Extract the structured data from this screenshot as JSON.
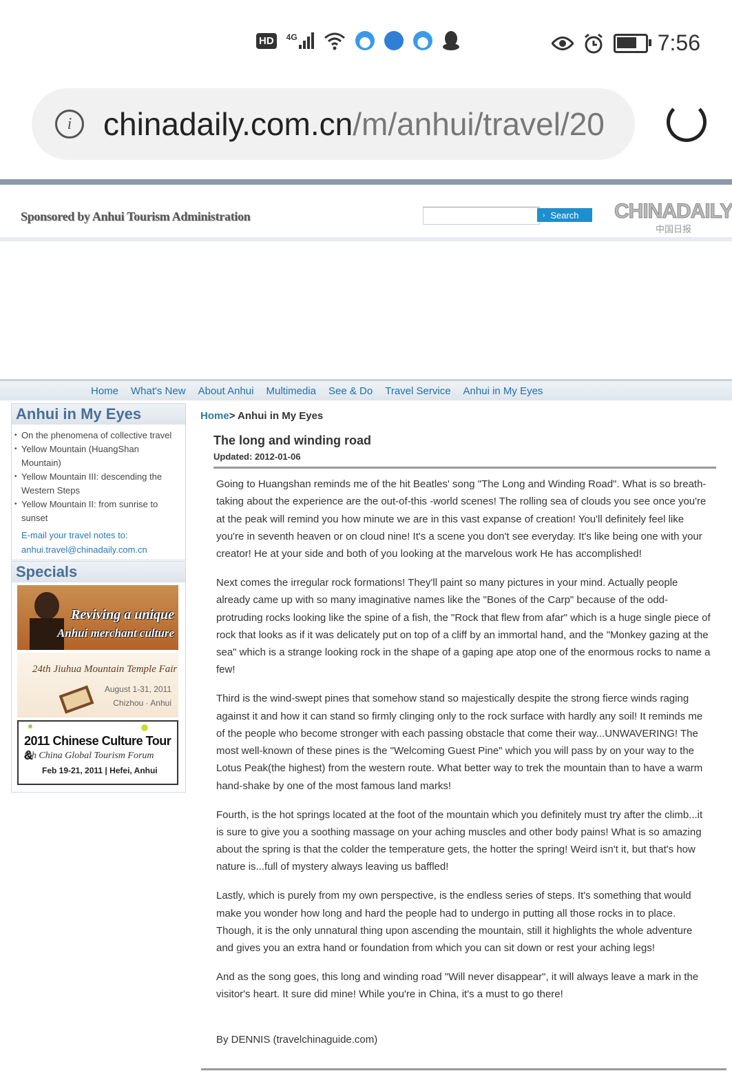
{
  "status_bar": {
    "hd_label": "HD",
    "network_label": "4G",
    "time": "7:56",
    "battery_level": 0.7
  },
  "browser": {
    "url_domain": "chinadaily.com.cn",
    "url_path": "/m/anhui/travel/20"
  },
  "header": {
    "sponsor_text": "Sponsored by Anhui Tourism Administration",
    "search_label": "Search",
    "logo_text": "CHINADAILY",
    "logo_sub": "中国日报"
  },
  "nav": {
    "items": [
      "Home",
      "What's New",
      "About Anhui",
      "Multimedia",
      "See & Do",
      "Travel Service",
      "Anhui in My Eyes"
    ]
  },
  "sidebar": {
    "eyes_title": "Anhui in My Eyes",
    "eyes_links": [
      "On the phenomena of collective travel",
      "Yellow Mountain (HuangShan Mountain)",
      "Yellow Mountain III: descending the Western Steps",
      "Yellow Mountain II: from sunrise to sunset"
    ],
    "email_label": "E-mail your travel notes to:",
    "email_address": "anhui.travel@chinadaily.com.cn",
    "specials_title": "Specials",
    "promo1_line1": "Reviving a unique",
    "promo1_line2": "Anhui merchant culture",
    "promo2_title": "24th Jiuhua Mountain Temple Fair",
    "promo2_date": "August 1-31, 2011",
    "promo2_place": "Chizhou · Anhui",
    "promo3_line1": "2011 Chinese Culture Tour &",
    "promo3_line2": "8th China Global Tourism Forum",
    "promo3_line3": "Feb 19-21, 2011 | Hefei, Anhui"
  },
  "article": {
    "breadcrumb_home": "Home",
    "breadcrumb_current": "> Anhui in My Eyes",
    "title": "The long and winding road",
    "updated": "Updated: 2012-01-06",
    "paragraphs": [
      "Going to Huangshan reminds me of the hit Beatles' song \"The Long and Winding Road\". What is so breath-taking about the experience are the out-of-this -world scenes! The rolling sea of clouds you see once you're at the peak will remind you how minute we are in this vast expanse of creation! You'll definitely feel like you're in seventh heaven or on cloud nine! It's a scene you don't see everyday. It's like being one with your creator! He at your side and both of you looking at the marvelous work He has accomplished!",
      "Next comes the irregular rock formations! They'll paint so many pictures in your mind. Actually people already came up with so many imaginative names like the \"Bones of the Carp\" because of the odd-protruding rocks looking like the spine of a fish, the \"Rock that flew from afar\" which is a huge single piece of rock that looks as if it was delicately put on top of a cliff by an immortal hand, and the \"Monkey gazing at the sea\" which is a strange looking rock in the shape of a gaping ape atop one of the enormous rocks to name a few!",
      "Third is the wind-swept pines that somehow stand so majestically despite the strong fierce winds raging against it and how it can stand so firmly clinging only to the rock surface with hardly any soil! It reminds me of the people who become stronger with each passing obstacle that come their way...UNWAVERING! The most well-known of these pines is the \"Welcoming Guest Pine\" which you will pass by on your way to the Lotus Peak(the highest) from the western route. What better way to trek the mountain than to have a warm hand-shake by one of the most famous land marks!",
      "Fourth, is the hot springs located at the foot of the mountain which you definitely must try after the climb...it is sure to give you a soothing massage on your aching muscles and other body pains! What is so amazing about the spring is that the colder the temperature gets, the hotter the spring! Weird isn't it, but that's how nature is...full of mystery always leaving us baffled!",
      "Lastly, which is purely from my own perspective, is the endless series of steps. It's something that would make you wonder how long and hard the people had to undergo in putting all those rocks in to place. Though, it is the only unnatural thing upon ascending the mountain, still it highlights the whole adventure and gives you an extra hand or foundation from which you can sit down or rest your aching legs!",
      "And as the song goes, this long and winding road \"Will never disappear\", it will always leave a mark in the visitor's heart. It sure did mine! While you're in China, it's a must to go there!"
    ],
    "byline": "By DENNIS (travelchinaguide.com)"
  }
}
